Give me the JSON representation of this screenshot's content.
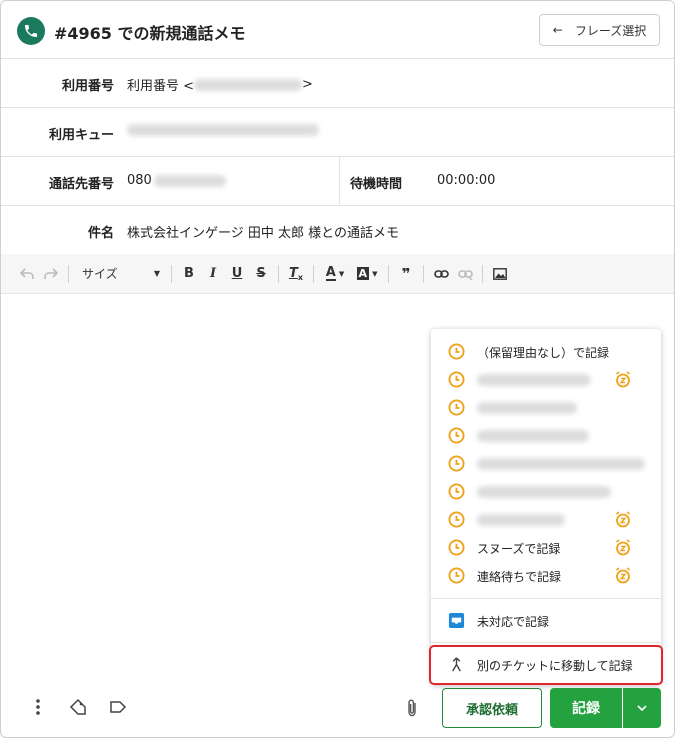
{
  "header": {
    "title": "#4965 での新規通話メモ",
    "phrase_button": "フレーズ選択",
    "phrase_arrow": "←"
  },
  "fields": {
    "usage_number_label": "利用番号",
    "usage_number_value_prefix": "利用番号 <",
    "usage_number_value_suffix": ">",
    "queue_label": "利用キュー",
    "callee_label": "通話先番号",
    "callee_value_prefix": "080",
    "wait_label": "待機時間",
    "wait_value": "00:00:00",
    "subject_label": "件名",
    "subject_value": "株式会社インゲージ 田中 太郎 様との通話メモ"
  },
  "toolbar": {
    "size_label": "サイズ",
    "bold": "B",
    "italic": "I",
    "underline": "U",
    "strike": "S",
    "clear_format": "T",
    "font_color": "A",
    "bg_color": "A",
    "quote": "❞"
  },
  "menu": {
    "items": [
      {
        "label": "（保留理由なし）で記録"
      },
      {
        "label": ""
      },
      {
        "label": ""
      },
      {
        "label": ""
      },
      {
        "label": ""
      },
      {
        "label": ""
      },
      {
        "label": ""
      },
      {
        "label": "スヌーズで記録"
      },
      {
        "label": "連絡待ちで記録"
      }
    ],
    "unhandled_label": "未対応で記録",
    "move_label": "別のチケットに移動して記録"
  },
  "actions": {
    "approve_label": "承認依頼",
    "record_label": "記録"
  },
  "colors": {
    "brand_green": "#23a23f",
    "clock_orange": "#f0a21a",
    "highlight_red": "#e0252b",
    "inbox_blue": "#1e88d8"
  }
}
